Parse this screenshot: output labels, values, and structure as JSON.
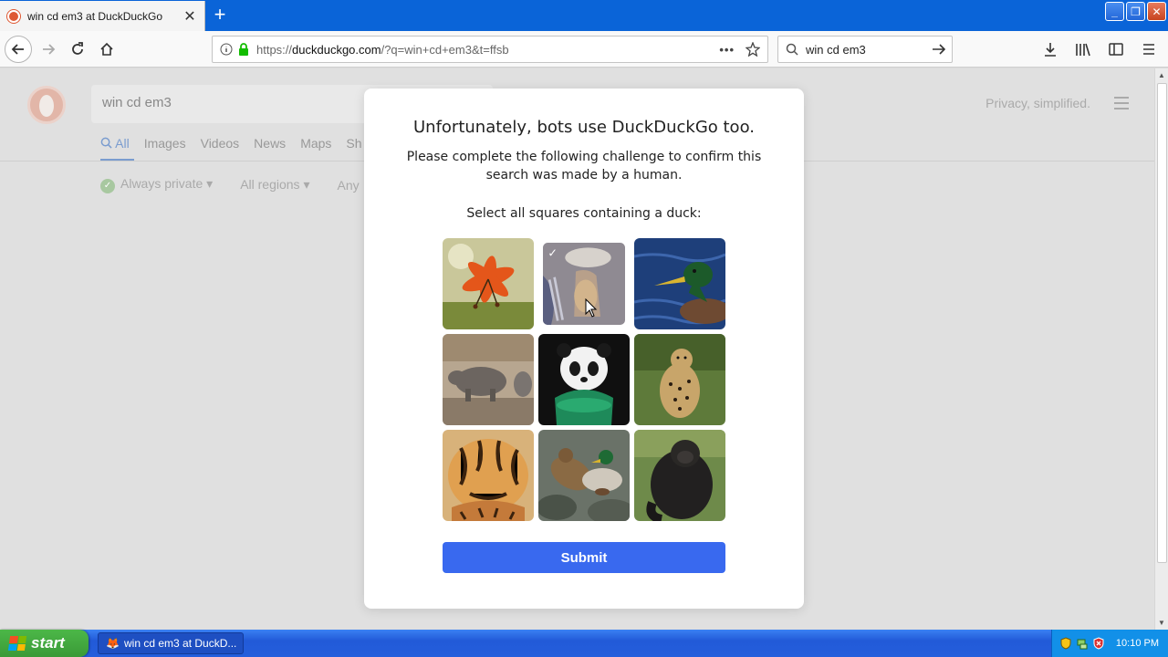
{
  "browser": {
    "tab_title": "win cd em3 at DuckDuckGo",
    "url_prefix": "https://",
    "url_host": "duckduckgo.com",
    "url_path": "/?q=win+cd+em3&t=ffsb",
    "search_value": "win cd em3"
  },
  "page": {
    "search_value": "win cd em3",
    "tabs": [
      "All",
      "Images",
      "Videos",
      "News",
      "Maps",
      "Sh"
    ],
    "filters": [
      "Always private",
      "All regions",
      "Any"
    ],
    "tagline": "Privacy, simplified."
  },
  "challenge": {
    "title": "Unfortunately, bots use DuckDuckGo too.",
    "subtitle": "Please complete the following challenge to confirm this search was made by a human.",
    "instruction": "Select all squares containing a duck:",
    "submit_label": "Submit",
    "tiles": [
      {
        "subject": "orange-lily",
        "selected": false
      },
      {
        "subject": "bottle-and-hand",
        "selected": true
      },
      {
        "subject": "mallard-duck-water",
        "selected": false
      },
      {
        "subject": "rhinoceros",
        "selected": false
      },
      {
        "subject": "panda-cub",
        "selected": false
      },
      {
        "subject": "cheetah",
        "selected": false
      },
      {
        "subject": "tiger-cub",
        "selected": false
      },
      {
        "subject": "ducks-on-rocks",
        "selected": false
      },
      {
        "subject": "gorilla",
        "selected": false
      }
    ]
  },
  "taskbar": {
    "start_label": "start",
    "window_label": "win cd em3 at DuckD...",
    "clock": "10:10 PM"
  },
  "colors": {
    "titlebar": "#0a64d8",
    "submit": "#3969ef",
    "ddg_orange": "#de5833"
  }
}
